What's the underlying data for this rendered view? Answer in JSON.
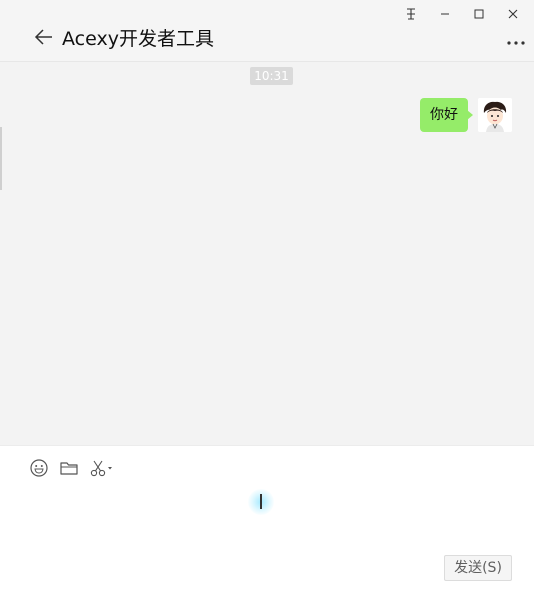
{
  "window": {
    "controls": {
      "pin": "pin-icon",
      "minimize": "minimize-icon",
      "maximize": "maximize-icon",
      "close": "close-icon"
    }
  },
  "header": {
    "title": "Acexy开发者工具",
    "back_icon": "back-arrow-icon",
    "more_icon": "more-icon"
  },
  "chat": {
    "timestamp": "10:31",
    "messages": [
      {
        "sender": "self",
        "text": "你好",
        "bubble_color": "#95ec69"
      }
    ]
  },
  "input": {
    "toolbar": [
      {
        "name": "emoji-icon"
      },
      {
        "name": "folder-icon"
      },
      {
        "name": "scissors-icon"
      }
    ],
    "send_label": "发送(S)"
  },
  "colors": {
    "background": "#f3f3f3",
    "bubble": "#95ec69",
    "timestamp_bg": "#dadada"
  }
}
